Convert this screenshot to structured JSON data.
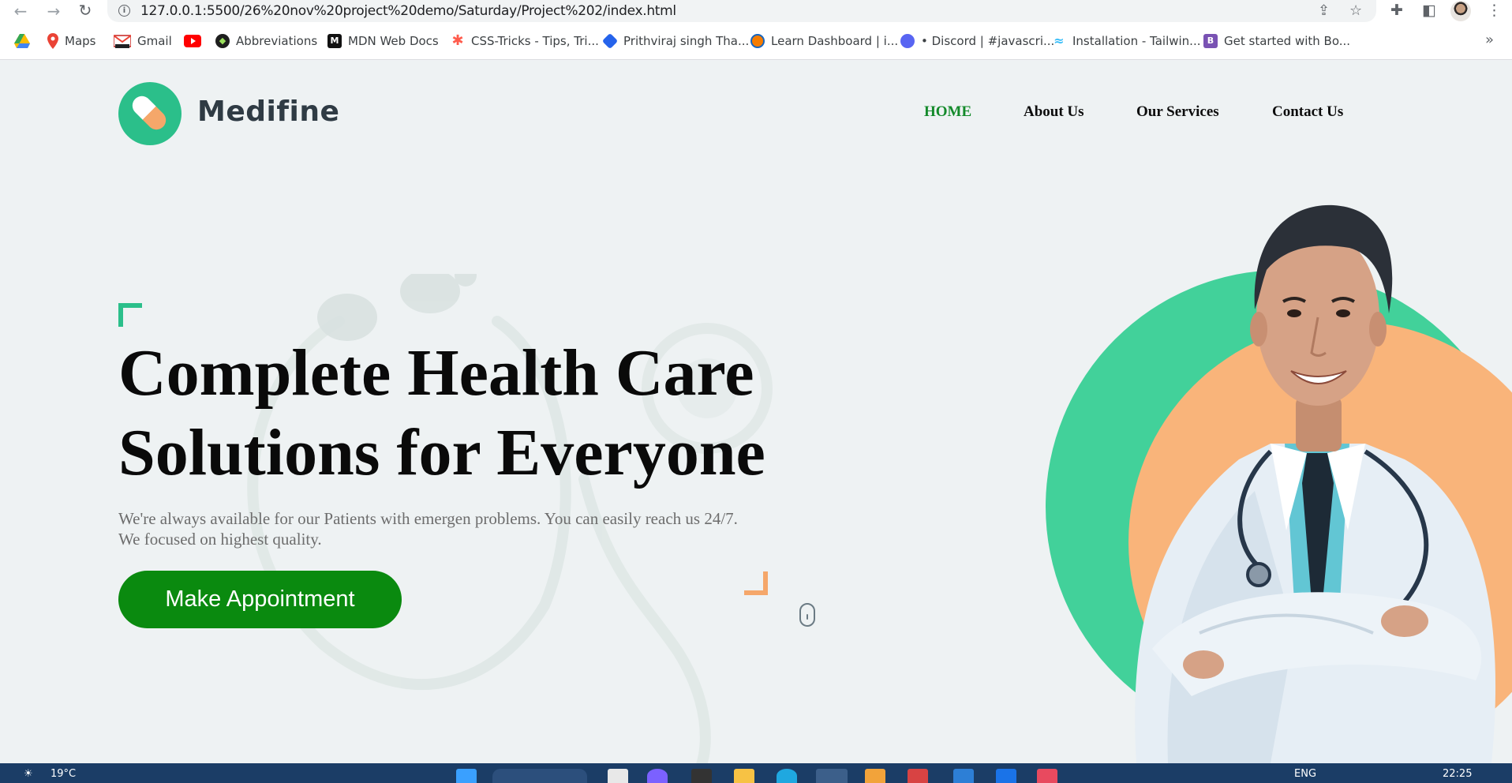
{
  "browser": {
    "url": "127.0.0.1:5500/26%20nov%20project%20demo/Saturday/Project%202/index.html",
    "bookmarks": [
      {
        "label": "",
        "icon": "google-drive-icon"
      },
      {
        "label": "Maps",
        "icon": "maps-icon"
      },
      {
        "label": "Gmail",
        "icon": "gmail-icon"
      },
      {
        "label": "",
        "icon": "youtube-icon"
      },
      {
        "label": "Abbreviations",
        "icon": "abbreviations-icon"
      },
      {
        "label": "MDN Web Docs",
        "icon": "mdn-icon"
      },
      {
        "label": "CSS-Tricks - Tips, Tri...",
        "icon": "css-tricks-icon"
      },
      {
        "label": "Prithviraj singh Tha...",
        "icon": "diamond-icon"
      },
      {
        "label": "Learn Dashboard | i...",
        "icon": "learn-icon"
      },
      {
        "label": "• Discord | #javascri...",
        "icon": "discord-icon"
      },
      {
        "label": "Installation - Tailwin...",
        "icon": "tailwind-icon"
      },
      {
        "label": "Get started with Bo...",
        "icon": "bootstrap-icon"
      }
    ],
    "more_label": "»"
  },
  "site": {
    "brand": "Medifine",
    "nav": [
      "HOME",
      "About Us",
      "Our Services",
      "Contact Us"
    ],
    "hero_title_line1": "Complete Health Care",
    "hero_title_line2": "Solutions for Everyone",
    "hero_sub_line1": "We're always available for our Patients with emergen problems. You can easily reach us 24/7.",
    "hero_sub_line2": "We focused on highest quality.",
    "cta_label": "Make Appointment",
    "colors": {
      "brand_green": "#2bbf8a",
      "cta_green": "#0a8a0f",
      "accent_orange": "#f5a76a",
      "nav_active": "#138a2a"
    }
  },
  "taskbar": {
    "weather": "19°C",
    "lang": "ENG",
    "time": "22:25"
  }
}
